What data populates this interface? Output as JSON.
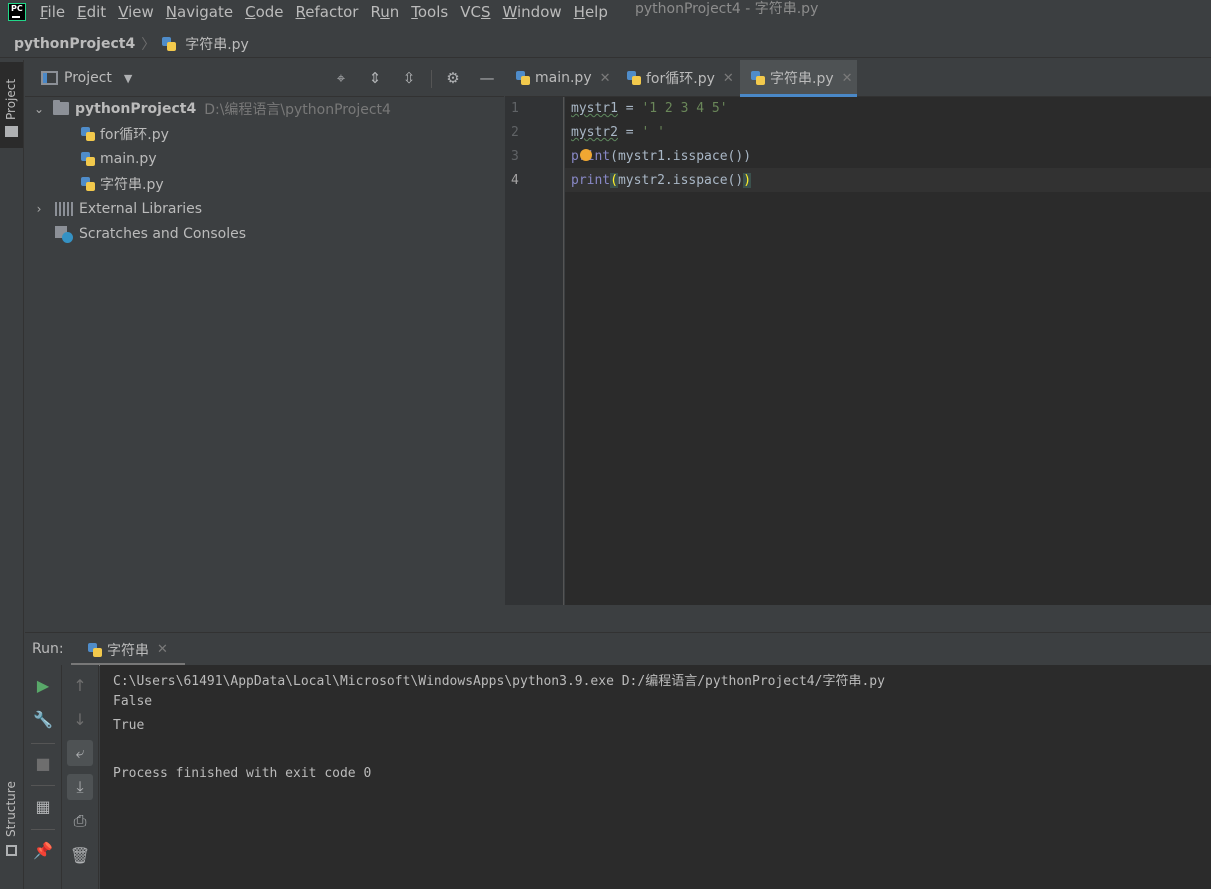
{
  "menubar": {
    "logo_text": "PC",
    "items": [
      {
        "label": "File",
        "mnemonic": "F"
      },
      {
        "label": "Edit",
        "mnemonic": "E"
      },
      {
        "label": "View",
        "mnemonic": "V"
      },
      {
        "label": "Navigate",
        "mnemonic": "N"
      },
      {
        "label": "Code",
        "mnemonic": "C"
      },
      {
        "label": "Refactor",
        "mnemonic": "R"
      },
      {
        "label": "Run",
        "mnemonic": "u"
      },
      {
        "label": "Tools",
        "mnemonic": "T"
      },
      {
        "label": "VCS",
        "mnemonic": "S"
      },
      {
        "label": "Window",
        "mnemonic": "W"
      },
      {
        "label": "Help",
        "mnemonic": "H"
      }
    ],
    "window_title": "pythonProject4 - 字符串.py"
  },
  "breadcrumb": {
    "project": "pythonProject4",
    "file": "字符串.py"
  },
  "left_stripe": {
    "project_label": "Project",
    "structure_label": "Structure"
  },
  "project_panel": {
    "title": "Project",
    "tree": {
      "root_name": "pythonProject4",
      "root_path": "D:\\编程语言\\pythonProject4",
      "files": [
        "for循环.py",
        "main.py",
        "字符串.py"
      ],
      "external_libraries": "External Libraries",
      "scratches": "Scratches and Consoles"
    }
  },
  "editor": {
    "tabs": [
      {
        "label": "main.py"
      },
      {
        "label": "for循环.py"
      },
      {
        "label": "字符串.py",
        "active": true
      }
    ],
    "line_numbers": [
      "1",
      "2",
      "3",
      "4"
    ],
    "code": {
      "l1_var": "mystr1",
      "l1_op": " = ",
      "l1_str": "'1 2 3 4 5'",
      "l2_var": "mystr2",
      "l2_op": " = ",
      "l2_str": "' '",
      "l3_fn": "print",
      "l3_rest": "(mystr1.isspace())",
      "l4_fn": "print",
      "l4_open": "(",
      "l4_mid": "mystr2.isspace()",
      "l4_close": ")"
    }
  },
  "run": {
    "label": "Run:",
    "tab": "字符串",
    "console": [
      "C:\\Users\\61491\\AppData\\Local\\Microsoft\\WindowsApps\\python3.9.exe D:/编程语言/pythonProject4/字符串.py",
      "False",
      "True",
      "",
      "Process finished with exit code 0"
    ]
  }
}
